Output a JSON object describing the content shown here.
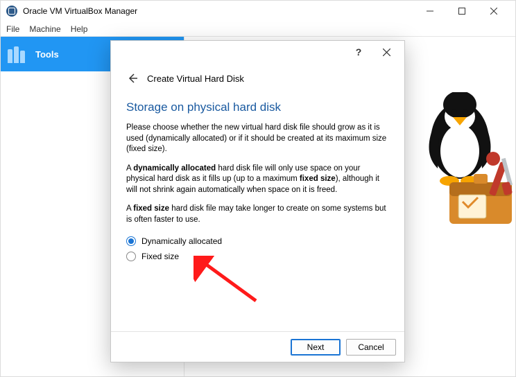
{
  "app": {
    "title": "Oracle VM VirtualBox Manager"
  },
  "menubar": {
    "file": "File",
    "machine": "Machine",
    "help": "Help"
  },
  "sidebar": {
    "tools_label": "Tools"
  },
  "dialog": {
    "help_glyph": "?",
    "crumb_title": "Create Virtual Hard Disk",
    "heading": "Storage on physical hard disk",
    "p1": "Please choose whether the new virtual hard disk file should grow as it is used (dynamically allocated) or if it should be created at its maximum size (fixed size).",
    "p2_a": "A ",
    "p2_b": "dynamically allocated",
    "p2_c": " hard disk file will only use space on your physical hard disk as it fills up (up to a maximum ",
    "p2_d": "fixed size",
    "p2_e": "), although it will not shrink again automatically when space on it is freed.",
    "p3_a": "A ",
    "p3_b": "fixed size",
    "p3_c": " hard disk file may take longer to create on some systems but is often faster to use.",
    "radio": {
      "dynamic": "Dynamically allocated",
      "fixed": "Fixed size"
    },
    "buttons": {
      "next": "Next",
      "cancel": "Cancel"
    }
  }
}
